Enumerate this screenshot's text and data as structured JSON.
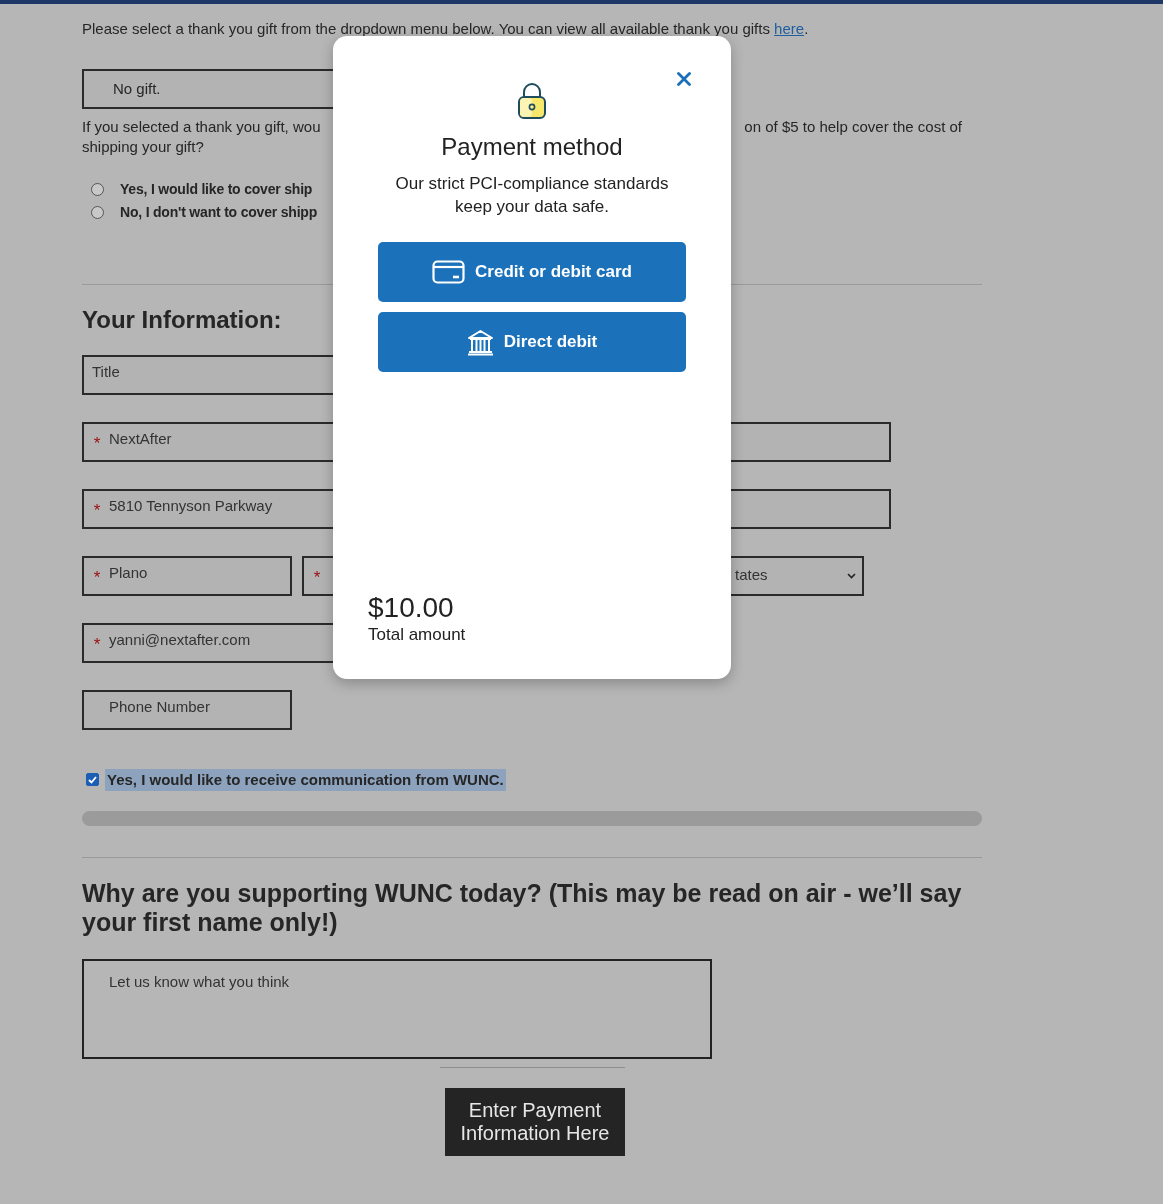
{
  "gift_section": {
    "intro": "Please select a thank you gift from the dropdown menu below. You can view all available thank you gifts",
    "intro_link": "here",
    "intro_end": ".",
    "gift_select": {
      "value": "No gift."
    },
    "shipping_question": {
      "left": "If you selected a thank you gift, wou",
      "right": "on of $5 to help cover the cost of",
      "second_line": "shipping your gift?"
    },
    "shipping_options": [
      {
        "label": "Yes, I would like to cover ship",
        "selected": false
      },
      {
        "label": "No, I don't want to cover shipp",
        "selected": false
      }
    ]
  },
  "your_information": {
    "heading": "Your Information:",
    "rows": [
      [
        {
          "kind": "medium",
          "placeholder": "Title"
        }
      ],
      [
        {
          "kind": "wide",
          "value": "NextAfter",
          "marker": "*"
        }
      ],
      [
        {
          "kind": "wide",
          "value": "5810 Tennyson Parkway",
          "marker": "*"
        }
      ],
      [
        {
          "kind": "short",
          "value": "Plano",
          "marker": "*"
        },
        {
          "kind": "medium",
          "marker": "*"
        },
        {
          "kind": "select",
          "value": "tates"
        }
      ],
      [
        {
          "kind": "medium",
          "value": "yanni@nextafter.com",
          "marker": "*"
        }
      ],
      [
        {
          "kind": "short",
          "placeholder": "Phone Number"
        }
      ]
    ]
  },
  "communication": {
    "label": "Yes, I would like to receive communication from WUNC.",
    "checked": true
  },
  "support": {
    "heading": "Why are you supporting WUNC today? (This may be read on air - we’ll say your first name only!)",
    "comment": {
      "placeholder": "Let us know what you think"
    }
  },
  "submit_button": "Enter Payment Information Here",
  "modal": {
    "title": "Payment method",
    "subtitle": "Our strict PCI-compliance standards keep your data safe.",
    "methods": [
      {
        "kind": "card",
        "label": "Credit or debit card"
      },
      {
        "kind": "bank",
        "label": "Direct debit"
      }
    ],
    "amount": "$10.00",
    "amount_label": "Total amount"
  }
}
